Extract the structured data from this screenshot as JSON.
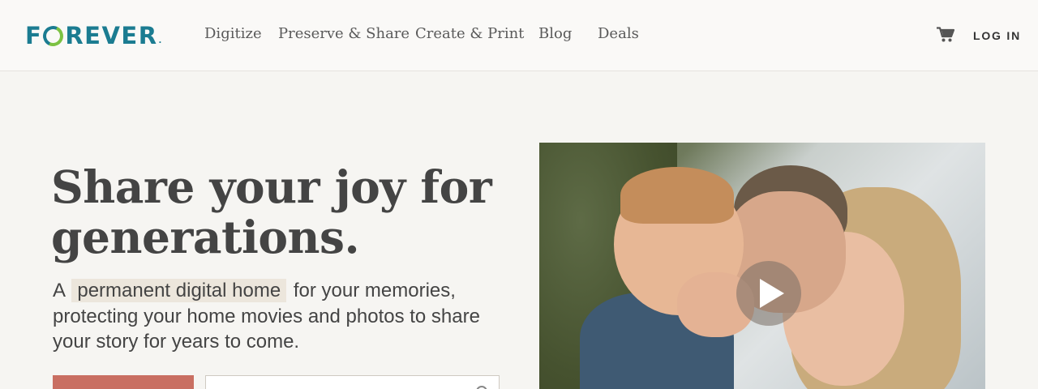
{
  "header": {
    "logo": {
      "left": "F",
      "right": "REVER",
      "mark": "."
    },
    "nav": [
      "Digitize",
      "Preserve & Share",
      "Create & Print",
      "Blog",
      "Deals"
    ],
    "cart_icon": "cart-icon",
    "login_label": "LOG IN"
  },
  "hero": {
    "headline": "Share your joy for generations.",
    "sub_prefix": "A",
    "sub_highlight": "permanent digital home",
    "sub_rest": "for your memories, protecting your home movies and photos to share your story for years to come."
  },
  "video": {
    "play_icon": "play-icon"
  },
  "colors": {
    "brand_teal": "#1b7c91",
    "brand_green": "#7cc242",
    "cta": "#c96f62",
    "background": "#f6f5f2"
  }
}
